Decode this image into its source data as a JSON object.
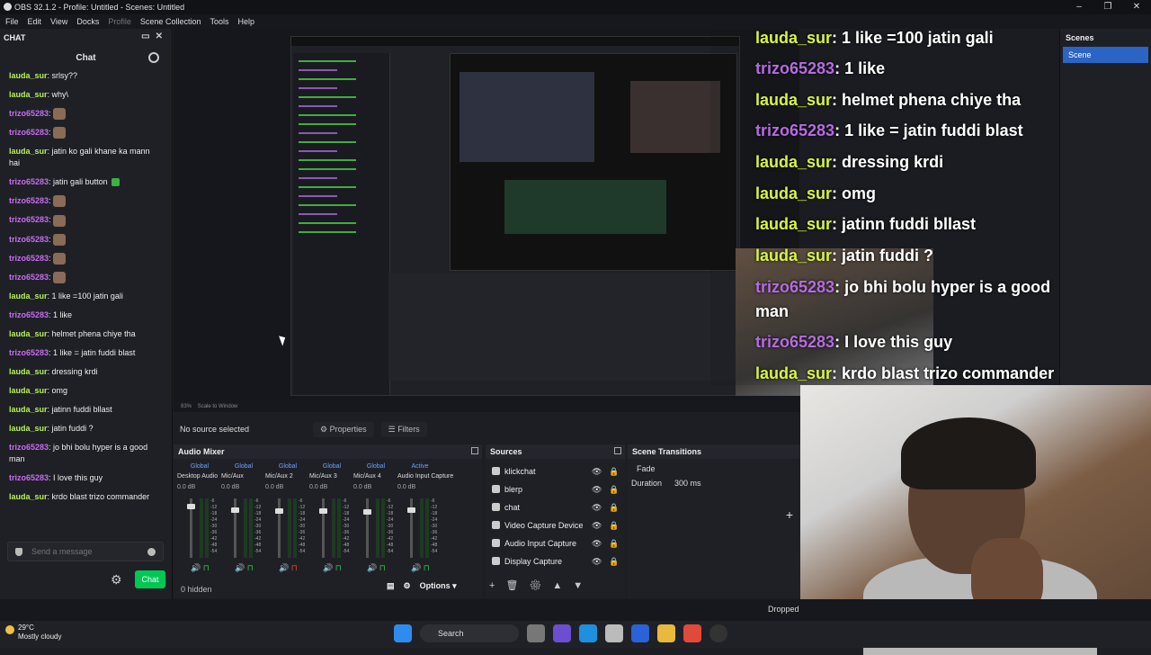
{
  "window": {
    "title": "OBS 32.1.2 - Profile: Untitled - Scenes: Untitled"
  },
  "menu": [
    "File",
    "Edit",
    "View",
    "Docks",
    "Profile",
    "Scene Collection",
    "Tools",
    "Help"
  ],
  "chat_dock": {
    "dock_title": "CHAT",
    "chat_header": "Chat",
    "messages": [
      {
        "user": "lauda_sur",
        "text": "srlsy??"
      },
      {
        "user": "lauda_sur",
        "text": "why\\"
      },
      {
        "user": "trizo65283",
        "text": ""
      },
      {
        "user": "trizo65283",
        "text": ""
      },
      {
        "user": "lauda_sur",
        "text": "jatin ko gali khane ka mann hai"
      },
      {
        "user": "trizo65283",
        "text": "jatin gali button"
      },
      {
        "user": "trizo65283",
        "text": ""
      },
      {
        "user": "trizo65283",
        "text": ""
      },
      {
        "user": "trizo65283",
        "text": ""
      },
      {
        "user": "trizo65283",
        "text": ""
      },
      {
        "user": "trizo65283",
        "text": ""
      },
      {
        "user": "lauda_sur",
        "text": "1 like =100 jatin gali"
      },
      {
        "user": "trizo65283",
        "text": "1 like"
      },
      {
        "user": "lauda_sur",
        "text": "helmet phena chiye tha"
      },
      {
        "user": "trizo65283",
        "text": "1 like = jatin fuddi blast"
      },
      {
        "user": "lauda_sur",
        "text": "dressing krdi"
      },
      {
        "user": "lauda_sur",
        "text": "omg"
      },
      {
        "user": "lauda_sur",
        "text": "jatinn fuddi bllast"
      },
      {
        "user": "lauda_sur",
        "text": "jatin fuddi ?"
      },
      {
        "user": "trizo65283",
        "text": "jo bhi bolu hyper is a good man"
      },
      {
        "user": "trizo65283",
        "text": "I love this guy"
      },
      {
        "user": "lauda_sur",
        "text": "krdo blast trizo commander"
      }
    ],
    "send_placeholder": "Send a message",
    "chat_button": "Chat"
  },
  "overlay_chat": [
    {
      "user": "lauda_sur",
      "text": "1 like =100 jatin gali"
    },
    {
      "user": "trizo65283",
      "text": "1 like"
    },
    {
      "user": "lauda_sur",
      "text": "helmet phena chiye tha"
    },
    {
      "user": "trizo65283",
      "text": "1 like = jatin fuddi blast"
    },
    {
      "user": "lauda_sur",
      "text": "dressing krdi"
    },
    {
      "user": "lauda_sur",
      "text": "omg"
    },
    {
      "user": "lauda_sur",
      "text": "jatinn fuddi bllast"
    },
    {
      "user": "lauda_sur",
      "text": "jatin fuddi ?"
    },
    {
      "user": "trizo65283",
      "text": "jo bhi bolu hyper is a good"
    },
    {
      "user": "",
      "text": "man"
    },
    {
      "user": "trizo65283",
      "text": "I love this guy"
    },
    {
      "user": "lauda_sur",
      "text": "krdo blast trizo commander"
    }
  ],
  "scenes": {
    "title": "Scenes",
    "items": [
      "Scene"
    ]
  },
  "preview_status": {
    "zoom": "83%",
    "mode": "Scale to Window"
  },
  "source_bar": {
    "no_source": "No source selected",
    "properties": "Properties",
    "filters": "Filters"
  },
  "audio_mixer": {
    "title": "Audio Mixer",
    "channels": [
      {
        "name": "Desktop Audio",
        "scope": "Global",
        "db": "0.0 dB",
        "level": 0.7
      },
      {
        "name": "Mic/Aux",
        "scope": "Global",
        "db": "0.0 dB",
        "level": 0.5
      },
      {
        "name": "Mic/Aux 2",
        "scope": "Global",
        "db": "0.0 dB",
        "level": 0.45
      },
      {
        "name": "Mic/Aux 3",
        "scope": "Global",
        "db": "0.0 dB",
        "level": 0.45
      },
      {
        "name": "Mic/Aux 4",
        "scope": "Global",
        "db": "0.0 dB",
        "level": 0.4
      },
      {
        "name": "Audio Input Capture",
        "scope": "Active",
        "db": "0.0 dB",
        "level": 0.5
      }
    ],
    "hidden": "0 hidden",
    "options": "Options"
  },
  "sources": {
    "title": "Sources",
    "items": [
      "klickchat",
      "blerp",
      "chat",
      "Video Capture Device",
      "Audio Input Capture",
      "Display Capture"
    ]
  },
  "transitions": {
    "title": "Scene Transitions",
    "type": "Fade",
    "duration_label": "Duration",
    "duration_value": "300 ms"
  },
  "status": {
    "dropped": "Dropped"
  },
  "taskbar": {
    "temp": "29°C",
    "weather": "Mostly cloudy",
    "search": "Search"
  }
}
